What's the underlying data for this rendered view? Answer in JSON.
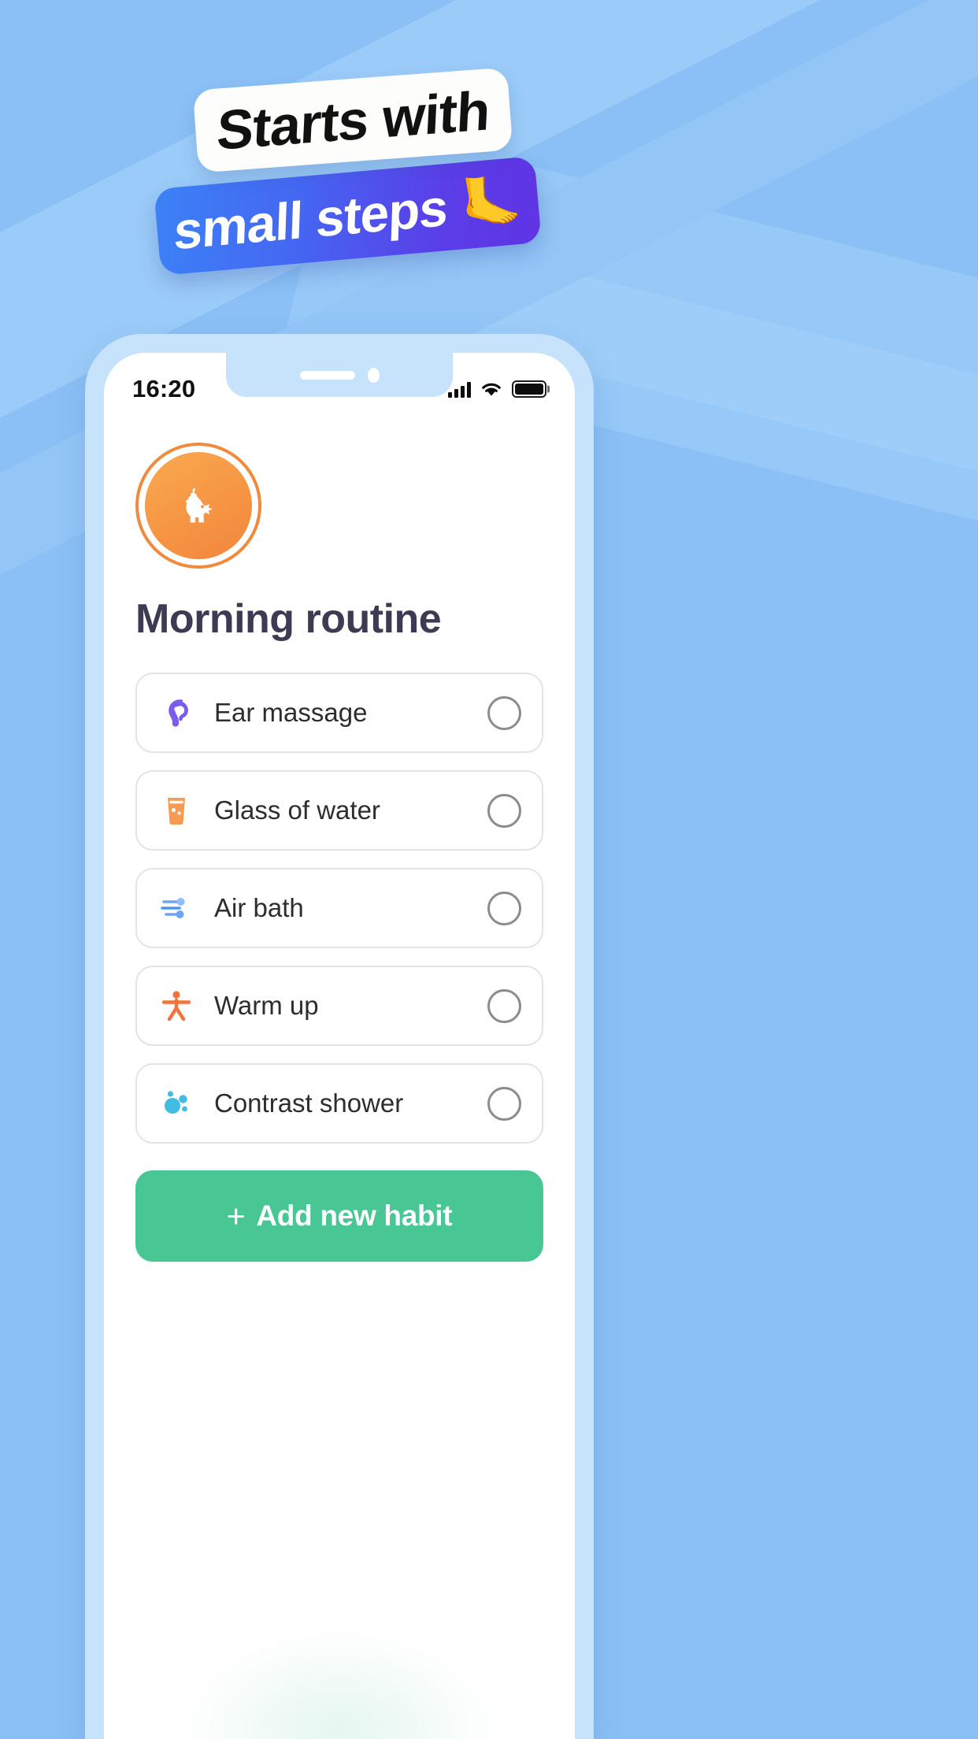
{
  "marketing": {
    "headline_line1": "Starts with",
    "headline_line2": "small steps",
    "headline_emoji": "🦶",
    "colors": {
      "background": "#8AC0F5",
      "banner_white": "#FDFDFB",
      "banner_gradient_start": "#3C82F6",
      "banner_gradient_end": "#6034E4"
    }
  },
  "phone": {
    "status_bar": {
      "time": "16:20",
      "signal_icon": "cellular-bars-icon",
      "wifi_icon": "wifi-icon",
      "battery_icon": "battery-full-icon"
    },
    "app": {
      "avatar_icon": "rooster-head-icon",
      "avatar_color": "#F3853C",
      "page_title": "Morning routine",
      "habits": [
        {
          "label": "Ear massage",
          "icon": "ear-icon",
          "icon_color": "#7B5CF0",
          "checked": false
        },
        {
          "label": "Glass of water",
          "icon": "water-glass-icon",
          "icon_color": "#F79B52",
          "checked": false
        },
        {
          "label": "Air bath",
          "icon": "wind-icon",
          "icon_color": "#6AA6F5",
          "checked": false
        },
        {
          "label": "Warm up",
          "icon": "person-stretch-icon",
          "icon_color": "#F4733C",
          "checked": false
        },
        {
          "label": "Contrast shower",
          "icon": "water-drops-icon",
          "icon_color": "#42BCE3",
          "checked": false
        }
      ],
      "add_button": {
        "plus": "+",
        "label": "Add new habit",
        "color": "#48C694"
      }
    }
  }
}
